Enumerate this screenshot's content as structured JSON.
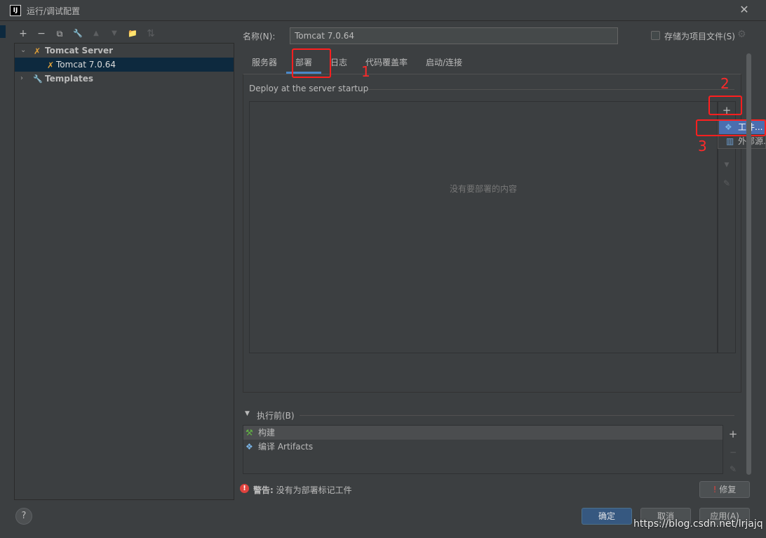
{
  "window": {
    "logo_text": "IJ",
    "title": "运行/调试配置",
    "close_glyph": "✕"
  },
  "toolbar": {
    "add": "+",
    "remove": "−",
    "copy": "⧉",
    "wrench": "🔧",
    "up": "▲",
    "down": "▼",
    "folder": "📁",
    "sort": "⇅"
  },
  "tree": {
    "items": [
      {
        "label": "Tomcat Server",
        "expanded": true,
        "icon": "tomcat-icon"
      },
      {
        "label": "Tomcat 7.0.64",
        "selected": true,
        "icon": "tomcat-icon"
      },
      {
        "label": "Templates",
        "expanded": false,
        "icon": "wrench-icon"
      }
    ]
  },
  "help": {
    "glyph": "?"
  },
  "config": {
    "name_label": "名称(N):",
    "name_value": "Tomcat 7.0.64",
    "store_label": "存储为项目文件(S)",
    "store_checked": false
  },
  "tabs": [
    {
      "label": "服务器"
    },
    {
      "label": "部署",
      "active": true
    },
    {
      "label": "日志"
    },
    {
      "label": "代码覆盖率"
    },
    {
      "label": "启动/连接"
    }
  ],
  "deploy": {
    "section_title": "Deploy at the server startup",
    "empty_text": "没有要部署的内容",
    "add_glyph": "+",
    "down_glyph": "▼",
    "edit_glyph": "✎"
  },
  "popup": {
    "items": [
      {
        "label": "工件...",
        "selected": true,
        "icon": "artifact-icon"
      },
      {
        "label": "外部源...",
        "selected": false,
        "icon": "external-source-icon"
      }
    ]
  },
  "annotations": [
    "1",
    "2",
    "3"
  ],
  "before_launch": {
    "title": "执行前(B)",
    "items": [
      {
        "label": "构建",
        "icon": "hammer-icon",
        "selected": true
      },
      {
        "label": "编译 Artifacts",
        "icon": "artifact-icon",
        "selected": false
      }
    ],
    "add_glyph": "+",
    "remove_glyph": "−",
    "edit_glyph": "✎"
  },
  "warning": {
    "icon": "!",
    "label": "警告:",
    "text": " 没有为部署标记工件",
    "fix_icon": "!",
    "fix_label": "修复"
  },
  "buttons": {
    "ok": "确定",
    "cancel": "取消",
    "apply": "应用(A)"
  },
  "watermark": "https://blog.csdn.net/lrjajq",
  "colors": {
    "background": "#3c3f41",
    "selection": "#0d293e",
    "popup_selection": "#4b6eaf",
    "tab_underline": "#4a88c7",
    "annotation": "#ff1f1f",
    "ok_button": "#365880",
    "warning": "#e0433e"
  }
}
